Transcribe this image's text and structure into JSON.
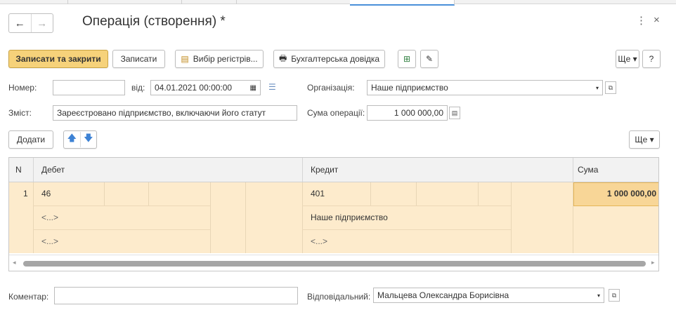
{
  "window": {
    "title": "Операція (створення) *",
    "back_icon": "←",
    "forward_icon": "→",
    "more_icon": "⋮",
    "close_icon": "×"
  },
  "toolbar": {
    "save_close": "Записати та закрити",
    "save": "Записати",
    "registers": "Вибір регістрів...",
    "accounting_note": "Бухгалтерська довідка",
    "more": "Ще ▾",
    "help": "?"
  },
  "form": {
    "number_label": "Номер:",
    "number_value": "",
    "from_label": "від:",
    "date_value": "04.01.2021 00:00:00",
    "org_label": "Організація:",
    "org_value": "Наше підприємство",
    "content_label": "Зміст:",
    "content_value": "Зареєстровано підприємство, включаючи його статут",
    "sum_label": "Сума операції:",
    "sum_value": "1 000 000,00",
    "comment_label": "Коментар:",
    "comment_value": "",
    "responsible_label": "Відповідальний:",
    "responsible_value": "Мальцева Олександра Борисівна"
  },
  "table_toolbar": {
    "add": "Додати",
    "more": "Ще ▾"
  },
  "table": {
    "columns": {
      "n": "N",
      "debit": "Дебет",
      "credit": "Кредит",
      "sum": "Сума"
    },
    "rows": [
      {
        "n": "1",
        "debit": "46",
        "debit_sub1": "<...>",
        "debit_sub2": "<...>",
        "credit": "401",
        "credit_sub1": "Наше підприємство",
        "credit_sub2": "<...>",
        "sum": "1 000 000,00"
      }
    ]
  },
  "colors": {
    "primary": "#f6d27a",
    "row_selected": "#fdebcc",
    "accent": "#4a90d9"
  }
}
